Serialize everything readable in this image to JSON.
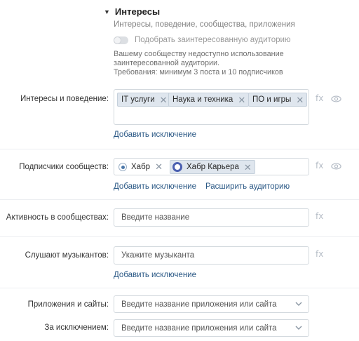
{
  "section": {
    "title": "Интересы",
    "subtitle": "Интересы, поведение, сообщества, приложения",
    "toggle_label": "Подобрать заинтересованную аудиторию",
    "note_line1": "Вашему сообществу недоступно использование",
    "note_line2": "заинтересованной аудитории.",
    "note_line3": "Требования: минимум 3 поста и 10 подписчиков"
  },
  "interests": {
    "label": "Интересы и поведение:",
    "chips": [
      "IT услуги",
      "Наука и техника",
      "ПО и игры"
    ],
    "add_exclusion": "Добавить исключение"
  },
  "subscribers": {
    "label": "Подписчики сообществ:",
    "chips": [
      "Хабр",
      "Хабр Карьера"
    ],
    "add_exclusion": "Добавить исключение",
    "expand": "Расширить аудиторию"
  },
  "activity": {
    "label": "Активность в сообществах:",
    "placeholder": "Введите название"
  },
  "musicians": {
    "label": "Слушают музыкантов:",
    "placeholder": "Укажите музыканта",
    "add_exclusion": "Добавить исключение"
  },
  "apps": {
    "label": "Приложения и сайты:",
    "placeholder": "Введите название приложения или сайта"
  },
  "except": {
    "label": "За исключением:",
    "placeholder": "Введите название приложения или сайта"
  },
  "icons": {
    "fx": "fx",
    "remove": "✕"
  }
}
